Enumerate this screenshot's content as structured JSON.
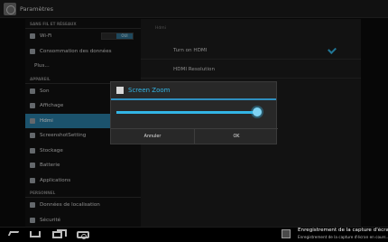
{
  "app": {
    "title": "Paramètres"
  },
  "sidebar": {
    "sections": [
      {
        "header": "SANS FIL ET RÉSEAUX",
        "items": [
          {
            "label": "Wi-Fi",
            "icon": "wifi-icon",
            "toggle": "OUI"
          },
          {
            "label": "Consommation des données",
            "icon": "data-usage-icon"
          },
          {
            "label": "Plus...",
            "icon": ""
          }
        ]
      },
      {
        "header": "APPAREIL",
        "items": [
          {
            "label": "Son",
            "icon": "sound-icon"
          },
          {
            "label": "Affichage",
            "icon": "display-icon"
          },
          {
            "label": "Hdmi",
            "icon": "hdmi-icon",
            "active": true
          },
          {
            "label": "ScreenshotSetting",
            "icon": "screenshot-icon"
          },
          {
            "label": "Stockage",
            "icon": "storage-icon"
          },
          {
            "label": "Batterie",
            "icon": "battery-icon"
          },
          {
            "label": "Applications",
            "icon": "apps-icon"
          }
        ]
      },
      {
        "header": "PERSONNEL",
        "items": [
          {
            "label": "Données de localisation",
            "icon": "location-icon"
          },
          {
            "label": "Sécurité",
            "icon": "security-icon"
          }
        ]
      }
    ]
  },
  "detail": {
    "header": "Hdmi",
    "rows": [
      {
        "label": "Turn on HDMI",
        "checked": true
      },
      {
        "label": "HDMI Resolution"
      }
    ]
  },
  "dialog": {
    "title": "Screen Zoom",
    "slider_value": 1.0,
    "cancel_label": "Annuler",
    "ok_label": "OK"
  },
  "notification": {
    "title": "Enregistrement de la capture d'écran...",
    "text": "Enregistrement de la capture d'écran en cours..."
  },
  "colors": {
    "accent": "#33b5e5",
    "active_item": "#2a7ea6"
  }
}
